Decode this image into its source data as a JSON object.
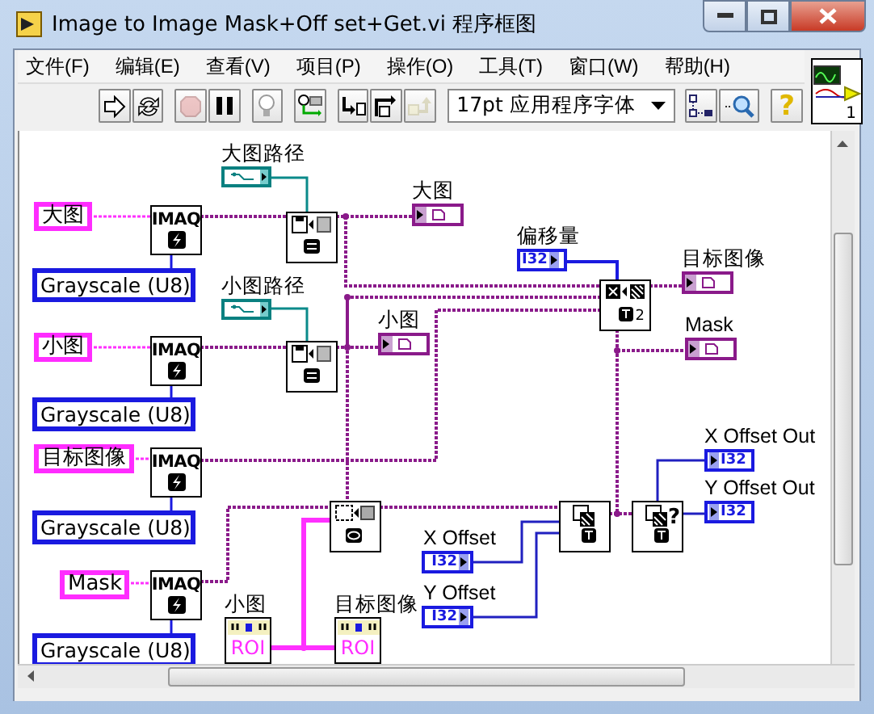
{
  "window": {
    "title": "Image to Image Mask+Off set+Get.vi 程序框图"
  },
  "menu": [
    {
      "label": "文件(F)"
    },
    {
      "label": "编辑(E)"
    },
    {
      "label": "查看(V)"
    },
    {
      "label": "项目(P)"
    },
    {
      "label": "操作(O)"
    },
    {
      "label": "工具(T)"
    },
    {
      "label": "窗口(W)"
    },
    {
      "label": "帮助(H)"
    }
  ],
  "toolbar": {
    "buttons": [
      {
        "kind": "run",
        "disabled": false
      },
      {
        "kind": "run-continuously",
        "disabled": false
      },
      {
        "kind": "abort",
        "disabled": true
      },
      {
        "kind": "pause",
        "disabled": false
      },
      {
        "kind": "highlight",
        "disabled": false
      },
      {
        "kind": "retain",
        "disabled": false
      },
      {
        "kind": "step-into",
        "disabled": false
      },
      {
        "kind": "step-over",
        "disabled": false
      },
      {
        "kind": "step-out",
        "disabled": true
      }
    ],
    "font_dropdown": "17pt 应用程序字体",
    "help": "?",
    "connector_number": "1"
  },
  "diagram": {
    "image_controls": [
      {
        "label": "大图"
      },
      {
        "label": "小图"
      },
      {
        "label": "目标图像"
      },
      {
        "label": "Mask"
      }
    ],
    "imaq_nodes": [
      {
        "label": "IMAQ"
      },
      {
        "label": "IMAQ"
      },
      {
        "label": "IMAQ"
      },
      {
        "label": "IMAQ"
      }
    ],
    "image_type_dropdowns": [
      {
        "value": "Grayscale (U8)"
      },
      {
        "value": "Grayscale (U8)"
      },
      {
        "value": "Grayscale (U8)"
      },
      {
        "value": "Grayscale (U8)"
      }
    ],
    "path_constants": [
      {
        "label": "大图路径"
      },
      {
        "label": "小图路径"
      }
    ],
    "function_nodes": [
      {
        "kind": "read-file"
      },
      {
        "kind": "read-file"
      },
      {
        "kind": "mask-offset",
        "badge": "2"
      },
      {
        "kind": "roi-to-mask"
      },
      {
        "kind": "offset"
      },
      {
        "kind": "offset-query",
        "badge": "?"
      }
    ],
    "image_indicators": [
      {
        "label": "大图"
      },
      {
        "label": "小图"
      },
      {
        "label": "目标图像"
      },
      {
        "label": "Mask"
      }
    ],
    "offset_constant": {
      "label": "偏移量",
      "type": "I32"
    },
    "numeric_controls": [
      {
        "label": "X Offset",
        "type": "I32"
      },
      {
        "label": "Y Offset",
        "type": "I32"
      }
    ],
    "numeric_indicators": [
      {
        "label": "X Offset Out",
        "type": "I32"
      },
      {
        "label": "Y Offset Out",
        "type": "I32"
      }
    ],
    "roi_constants": [
      {
        "label": "小图",
        "text": "ROI"
      },
      {
        "label": "目标图像",
        "text": "ROI"
      }
    ]
  }
}
